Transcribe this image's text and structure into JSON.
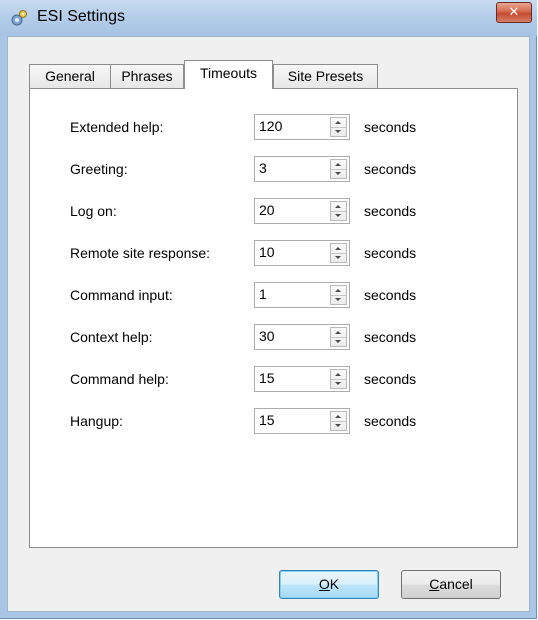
{
  "window": {
    "title": "ESI Settings",
    "close_symbol": "✕"
  },
  "tabs": [
    {
      "label": "General",
      "active": false
    },
    {
      "label": "Phrases",
      "active": false
    },
    {
      "label": "Timeouts",
      "active": true
    },
    {
      "label": "Site Presets",
      "active": false
    }
  ],
  "timeouts": {
    "unit": "seconds",
    "rows": [
      {
        "label": "Extended help:",
        "value": "120"
      },
      {
        "label": "Greeting:",
        "value": "3"
      },
      {
        "label": "Log on:",
        "value": "20"
      },
      {
        "label": "Remote site response:",
        "value": "10"
      },
      {
        "label": "Command input:",
        "value": "1"
      },
      {
        "label": "Context help:",
        "value": "30"
      },
      {
        "label": "Command help:",
        "value": "15"
      },
      {
        "label": "Hangup:",
        "value": "15"
      }
    ]
  },
  "buttons": {
    "ok": {
      "accel": "O",
      "rest": "K"
    },
    "cancel": {
      "accel": "C",
      "rest": "ancel"
    }
  },
  "colors": {
    "titlebar": "#b3cde9",
    "close_button": "#c44a2e",
    "default_button_border": "#3c7fb1"
  }
}
